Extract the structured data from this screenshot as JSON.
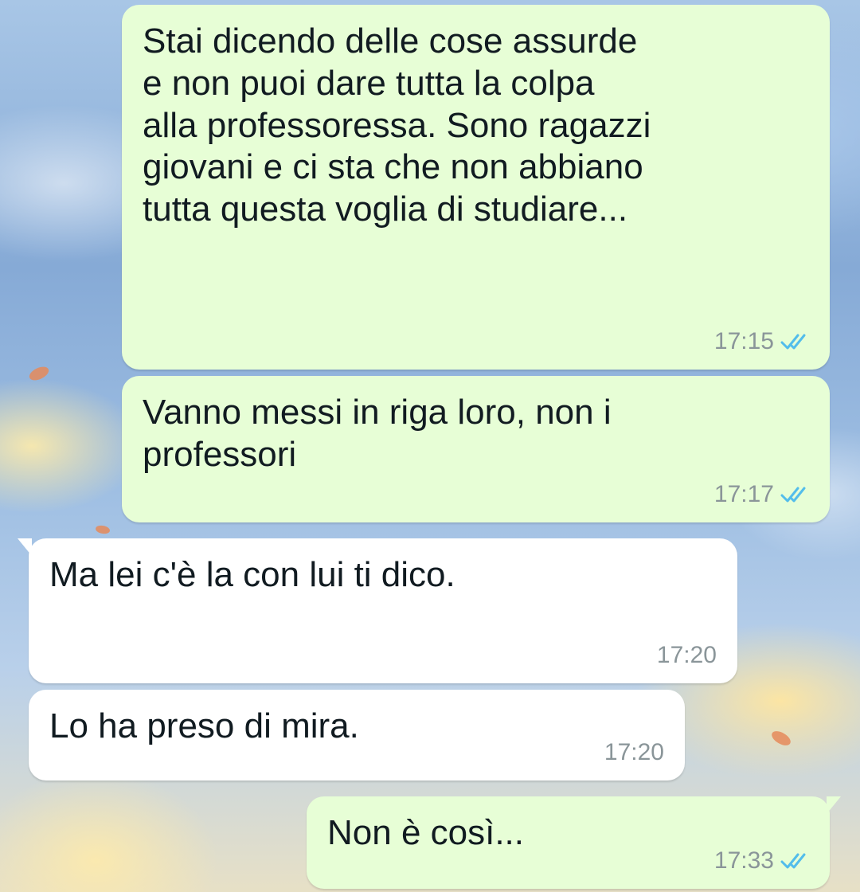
{
  "messages": [
    {
      "direction": "outgoing",
      "text": "Stai dicendo delle cose assurde\ne non puoi dare tutta la colpa\nalla professoressa. Sono ragazzi\ngiovani e ci sta che non abbiano\ntutta questa voglia di studiare...",
      "time": "17:15",
      "status_icon": "double-check-read-icon"
    },
    {
      "direction": "outgoing",
      "text": "Vanno messi in riga loro, non i\nprofessori",
      "time": "17:17",
      "status_icon": "double-check-read-icon"
    },
    {
      "direction": "incoming",
      "text": "Ma lei c'è la con lui ti dico.",
      "time": "17:20"
    },
    {
      "direction": "incoming",
      "text": "Lo ha preso di mira.",
      "time": "17:20"
    },
    {
      "direction": "outgoing",
      "text": "Non è così...",
      "time": "17:33",
      "status_icon": "double-check-read-icon"
    }
  ],
  "colors": {
    "outgoing_bubble": "#e7fed6",
    "incoming_bubble": "#ffffff",
    "read_ticks": "#53bdeb",
    "timestamp": "#8a9599"
  }
}
